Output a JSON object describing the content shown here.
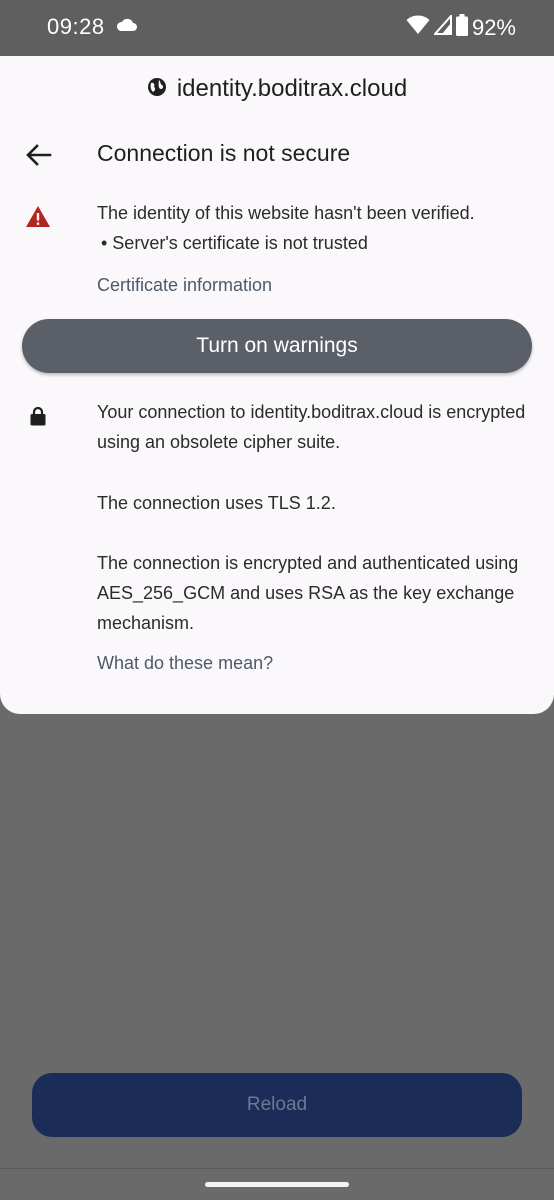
{
  "status_bar": {
    "time": "09:28",
    "battery": "92%",
    "icons": [
      "cloud-icon",
      "wifi-icon",
      "signal-icon",
      "battery-icon"
    ]
  },
  "sheet": {
    "url": "identity.boditrax.cloud",
    "title": "Connection is not secure",
    "identity_warning": "The identity of this website hasn't been verified.",
    "certificate_issue": "• Server's certificate is not trusted",
    "certificate_link": "Certificate information",
    "warnings_button": "Turn on warnings",
    "connection_text": "Your connection to identity.boditrax.cloud is encrypted using an obsolete cipher suite.",
    "tls_text": "The connection uses TLS 1.2.",
    "cipher_text": "The connection is encrypted and authenticated using AES_256_GCM and uses RSA as the key exchange mechanism.",
    "meaning_link": "What do these mean?"
  },
  "page": {
    "reload_button": "Reload"
  },
  "colors": {
    "sheet_bg": "#fbf8fb",
    "warning_red": "#b3261e",
    "button_gray": "#5b6068",
    "reload_blue": "#1b2c59",
    "link_color": "#4d5a6a"
  }
}
